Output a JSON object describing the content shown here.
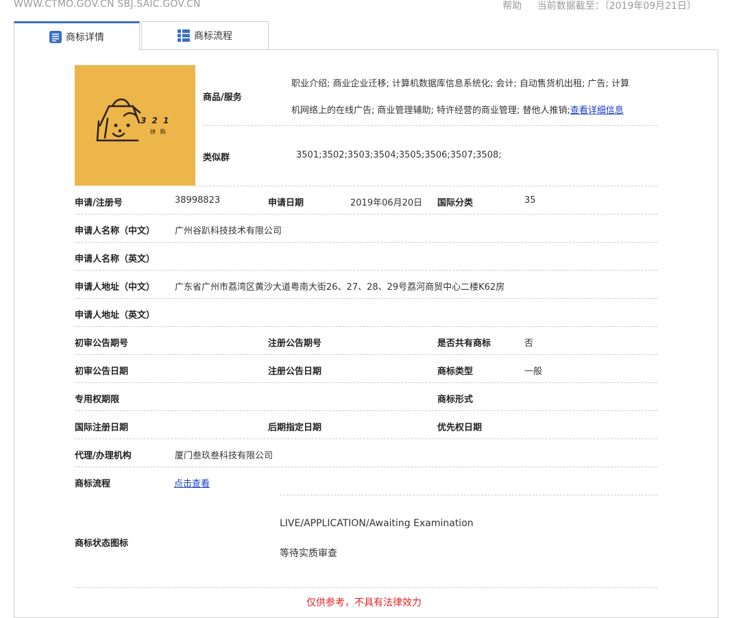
{
  "header": {
    "site_urls": "WWW.CTMO.GOV.CN SBJ.SAIC.GOV.CN",
    "help": "帮助",
    "data_date": "当前数据截至：（2019年09月21日）"
  },
  "tabs": [
    {
      "label": "商标详情",
      "icon": "document-list-icon",
      "active": true
    },
    {
      "label": "商标流程",
      "icon": "grid-list-icon",
      "active": false
    }
  ],
  "logo": {
    "text_numbers": "3 2 1",
    "text_sub": "拼 购",
    "bg_color": "#ecb64a"
  },
  "goods": {
    "label": "商品/服务",
    "line1": "职业介绍; 商业企业迁移; 计算机数据库信息系统化; 会计; 自动售货机出租; 广告; 计算",
    "line2": "机网络上的在线广告; 商业管理辅助; 特许经营的商业管理; 替他人推销;",
    "more_link": "查看详细信息"
  },
  "similar_group": {
    "label": "类似群",
    "value": "3501;3502;3503;3504;3505;3506;3507;3508;"
  },
  "fields": {
    "reg_no_label": "申请/注册号",
    "reg_no": "38998823",
    "apply_date_label": "申请日期",
    "apply_date": "2019年06月20日",
    "intl_class_label": "国际分类",
    "intl_class": "35",
    "applicant_cn_label": "申请人名称（中文）",
    "applicant_cn": "广州谷趴科技技术有限公司",
    "applicant_en_label": "申请人名称（英文）",
    "applicant_en": "",
    "address_cn_label": "申请人地址（中文）",
    "address_cn": "广东省广州市荔湾区黄沙大道粤南大街26、27、28、29号荔河商贸中心二楼K62房",
    "address_en_label": "申请人地址（英文）",
    "address_en": "",
    "prelim_no_label": "初审公告期号",
    "reg_pub_no_label": "注册公告期号",
    "shared_label": "是否共有商标",
    "shared": "否",
    "prelim_date_label": "初审公告日期",
    "reg_pub_date_label": "注册公告日期",
    "tm_type_label": "商标类型",
    "tm_type": "一般",
    "exclusive_label": "专用权期限",
    "tm_form_label": "商标形式",
    "intl_reg_date_label": "国际注册日期",
    "later_date_label": "后期指定日期",
    "priority_label": "优先权日期",
    "agent_label": "代理/办理机构",
    "agent": "厦门叁玖叁科技有限公司",
    "flow_label": "商标流程",
    "flow_link": "点击查看",
    "status_label": "商标状态图标",
    "status_en": "LIVE/APPLICATION/Awaiting Examination",
    "status_cn": "等待实质审查"
  },
  "notice": "仅供参考，不具有法律效力"
}
